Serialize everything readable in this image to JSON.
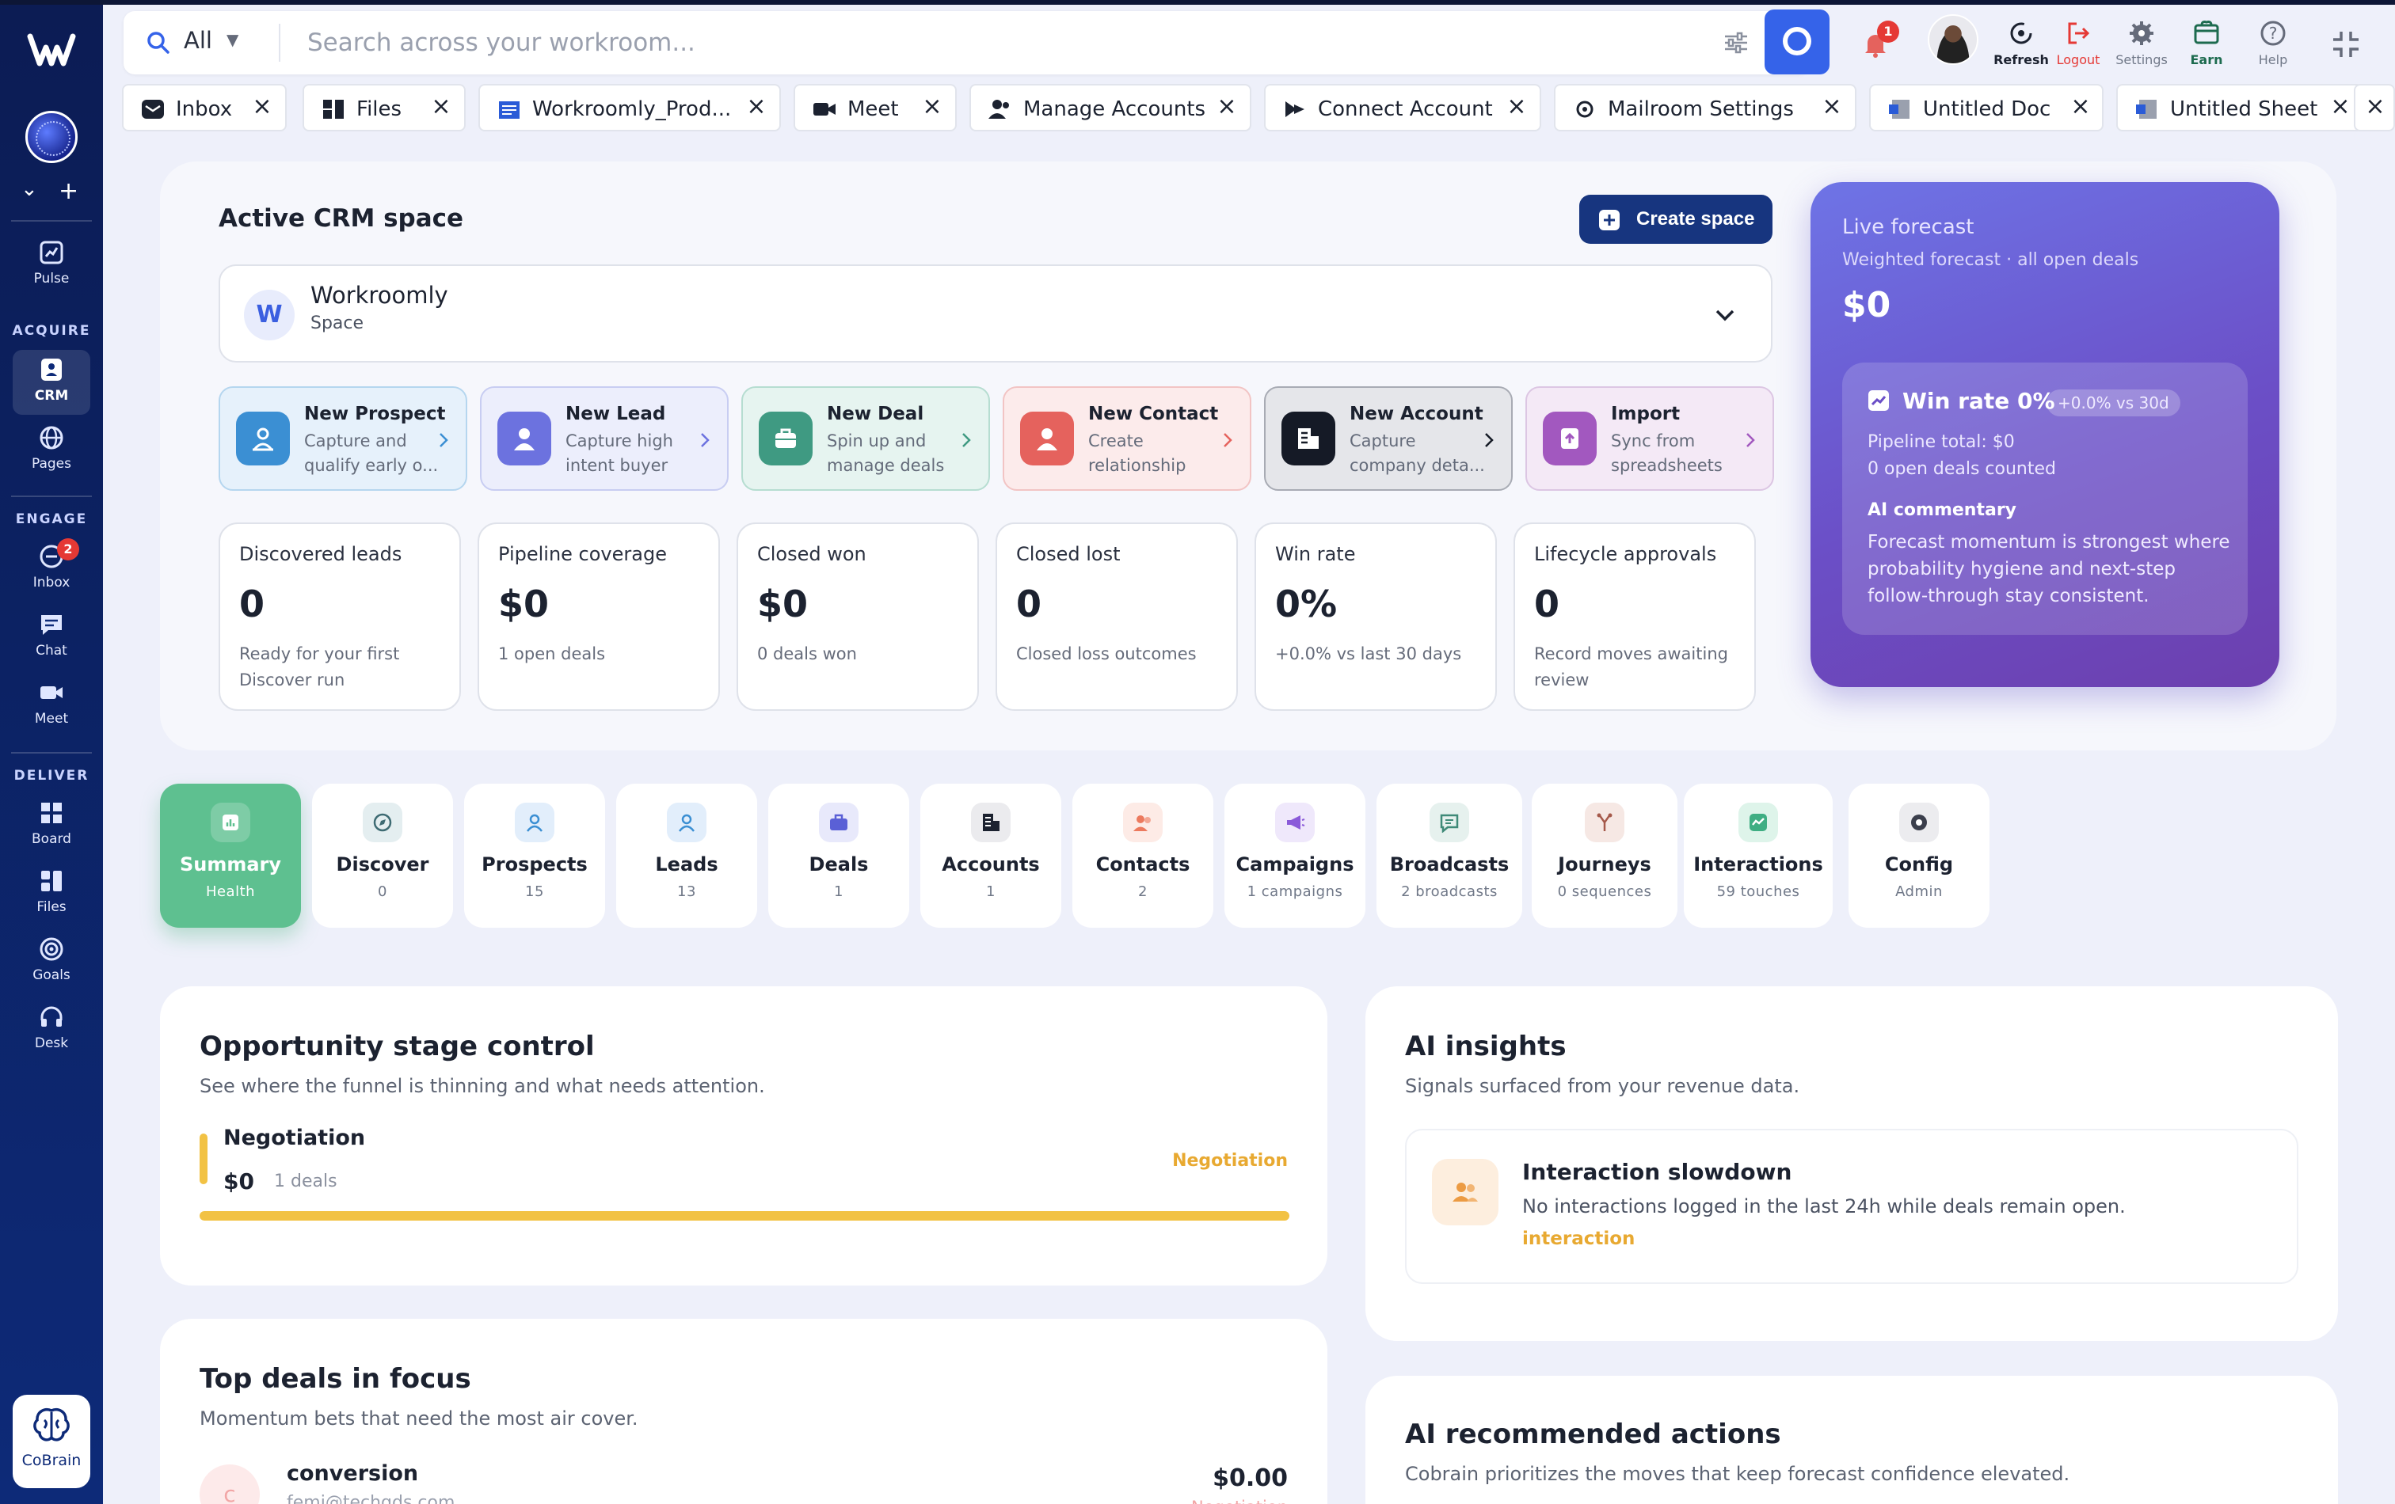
{
  "header": {
    "search_scope": "All",
    "search_placeholder": "Search across your workroom...",
    "notifications_count": "1",
    "actions": {
      "refresh": "Refresh",
      "logout": "Logout",
      "settings": "Settings",
      "earn": "Earn",
      "help": "Help"
    }
  },
  "tabs": [
    {
      "label": "Inbox",
      "icon": "inbox-icon"
    },
    {
      "label": "Files",
      "icon": "files-icon"
    },
    {
      "label": "Workroomly_Prod...",
      "icon": "document-icon"
    },
    {
      "label": "Meet",
      "icon": "video-icon"
    },
    {
      "label": "Manage Accounts",
      "icon": "users-icon"
    },
    {
      "label": "Connect Account",
      "icon": "link-icon"
    },
    {
      "label": "Mailroom Settings",
      "icon": "gear-icon"
    },
    {
      "label": "Untitled Doc",
      "icon": "doc-icon"
    },
    {
      "label": "Untitled Sheet",
      "icon": "sheet-icon"
    }
  ],
  "sidebar": {
    "groups": {
      "acquire": "ACQUIRE",
      "engage": "ENGAGE",
      "deliver": "DELIVER"
    },
    "items": {
      "pulse": "Pulse",
      "crm": "CRM",
      "pages": "Pages",
      "inbox": "Inbox",
      "inbox_badge": "2",
      "chat": "Chat",
      "meet": "Meet",
      "board": "Board",
      "files": "Files",
      "goals": "Goals",
      "desk": "Desk"
    },
    "cobrain": "CoBrain"
  },
  "crm": {
    "title": "Active CRM space",
    "create_label": "Create space",
    "space": {
      "initial": "W",
      "name": "Workroomly",
      "type": "Space"
    },
    "quick_actions": [
      {
        "title": "New Prospect",
        "desc": "Capture and qualify early o...",
        "bg": "#e6f1fb",
        "border": "#b5d6ef",
        "accent": "#3b8fd3"
      },
      {
        "title": "New Lead",
        "desc": "Capture high intent buyer",
        "bg": "#eceefc",
        "border": "#c8cdf2",
        "accent": "#6c72df"
      },
      {
        "title": "New Deal",
        "desc": "Spin up and manage deals",
        "bg": "#e6f4f0",
        "border": "#b6ddd1",
        "accent": "#3f9a82"
      },
      {
        "title": "New Contact",
        "desc": "Create relationship",
        "bg": "#fcebeb",
        "border": "#f2c4c4",
        "accent": "#e5625d"
      },
      {
        "title": "New Account",
        "desc": "Capture company deta...",
        "bg": "#e5e6ea",
        "border": "#a8abb4",
        "accent": "#151a26"
      },
      {
        "title": "Import",
        "desc": "Sync from spreadsheets",
        "bg": "#f4e9f6",
        "border": "#dcc6e3",
        "accent": "#a258bf"
      }
    ],
    "stats": [
      {
        "label": "Discovered leads",
        "value": "0",
        "sub": "Ready for your first Discover run"
      },
      {
        "label": "Pipeline coverage",
        "value": "$0",
        "sub": "1 open deals"
      },
      {
        "label": "Closed won",
        "value": "$0",
        "sub": "0 deals won"
      },
      {
        "label": "Closed lost",
        "value": "0",
        "sub": "Closed loss outcomes"
      },
      {
        "label": "Win rate",
        "value": "0%",
        "sub": "+0.0% vs last 30 days"
      },
      {
        "label": "Lifecycle approvals",
        "value": "0",
        "sub": "Record moves awaiting review"
      }
    ]
  },
  "forecast": {
    "title": "Live forecast",
    "subtitle": "Weighted forecast · all open deals",
    "value": "$0",
    "win_rate": "Win rate 0%",
    "win_delta": "+0.0% vs 30d",
    "pipeline_total": "Pipeline total: $0",
    "open_deals": "0 open deals counted",
    "ai_heading": "AI commentary",
    "ai_text": "Forecast momentum is strongest where probability hygiene and next-step follow-through stay consistent."
  },
  "modules": [
    {
      "title": "Summary",
      "sub": "Health",
      "icon": "chart-icon",
      "bg": "#ffffff33",
      "fg": "#ffffff"
    },
    {
      "title": "Discover",
      "sub": "0",
      "icon": "compass-icon",
      "bg": "#e4eef0",
      "fg": "#3e6b73"
    },
    {
      "title": "Prospects",
      "sub": "15",
      "icon": "user-icon",
      "bg": "#e2eefb",
      "fg": "#3b8fd3"
    },
    {
      "title": "Leads",
      "sub": "13",
      "icon": "user-icon",
      "bg": "#e2eefb",
      "fg": "#3b8fd3"
    },
    {
      "title": "Deals",
      "sub": "1",
      "icon": "briefcase-icon",
      "bg": "#e8e9fb",
      "fg": "#5a60d6"
    },
    {
      "title": "Accounts",
      "sub": "1",
      "icon": "building-icon",
      "bg": "#ebebee",
      "fg": "#1c2230"
    },
    {
      "title": "Contacts",
      "sub": "2",
      "icon": "contacts-icon",
      "bg": "#fdebe6",
      "fg": "#ec7a5e"
    },
    {
      "title": "Campaigns",
      "sub": "1 campaigns",
      "icon": "megaphone-icon",
      "bg": "#efe8fb",
      "fg": "#8a5ad9"
    },
    {
      "title": "Broadcasts",
      "sub": "2 broadcasts",
      "icon": "message-icon",
      "bg": "#e6f1ee",
      "fg": "#3f8a78"
    },
    {
      "title": "Journeys",
      "sub": "0 sequences",
      "icon": "branch-icon",
      "bg": "#f6e8e4",
      "fg": "#a5594a"
    },
    {
      "title": "Interactions",
      "sub": "59 touches",
      "icon": "pulse-icon",
      "bg": "#def4ea",
      "fg": "#3fae83"
    },
    {
      "title": "Config",
      "sub": "Admin",
      "icon": "settings-icon",
      "bg": "#ececef",
      "fg": "#3b3f4c"
    }
  ],
  "stage": {
    "title": "Opportunity stage control",
    "subtitle": "See where the funnel is thinning and what needs attention.",
    "name": "Negotiation",
    "value": "$0",
    "count": "1 deals",
    "tag": "Negotiation",
    "share": 1.0
  },
  "insights": {
    "title": "AI insights",
    "subtitle": "Signals surfaced from your revenue data.",
    "item": {
      "title": "Interaction slowdown",
      "desc": "No interactions logged in the last 24h while deals remain open.",
      "tag": "interaction"
    }
  },
  "top_deals": {
    "title": "Top deals in focus",
    "subtitle": "Momentum bets that need the most air cover.",
    "deal": {
      "initial": "c",
      "name": "conversion",
      "email": "femi@techgds.com",
      "amount": "$0.00",
      "stage": "Negotiation"
    }
  },
  "recommended": {
    "title": "AI recommended actions",
    "subtitle": "Cobrain prioritizes the moves that keep forecast confidence elevated."
  }
}
